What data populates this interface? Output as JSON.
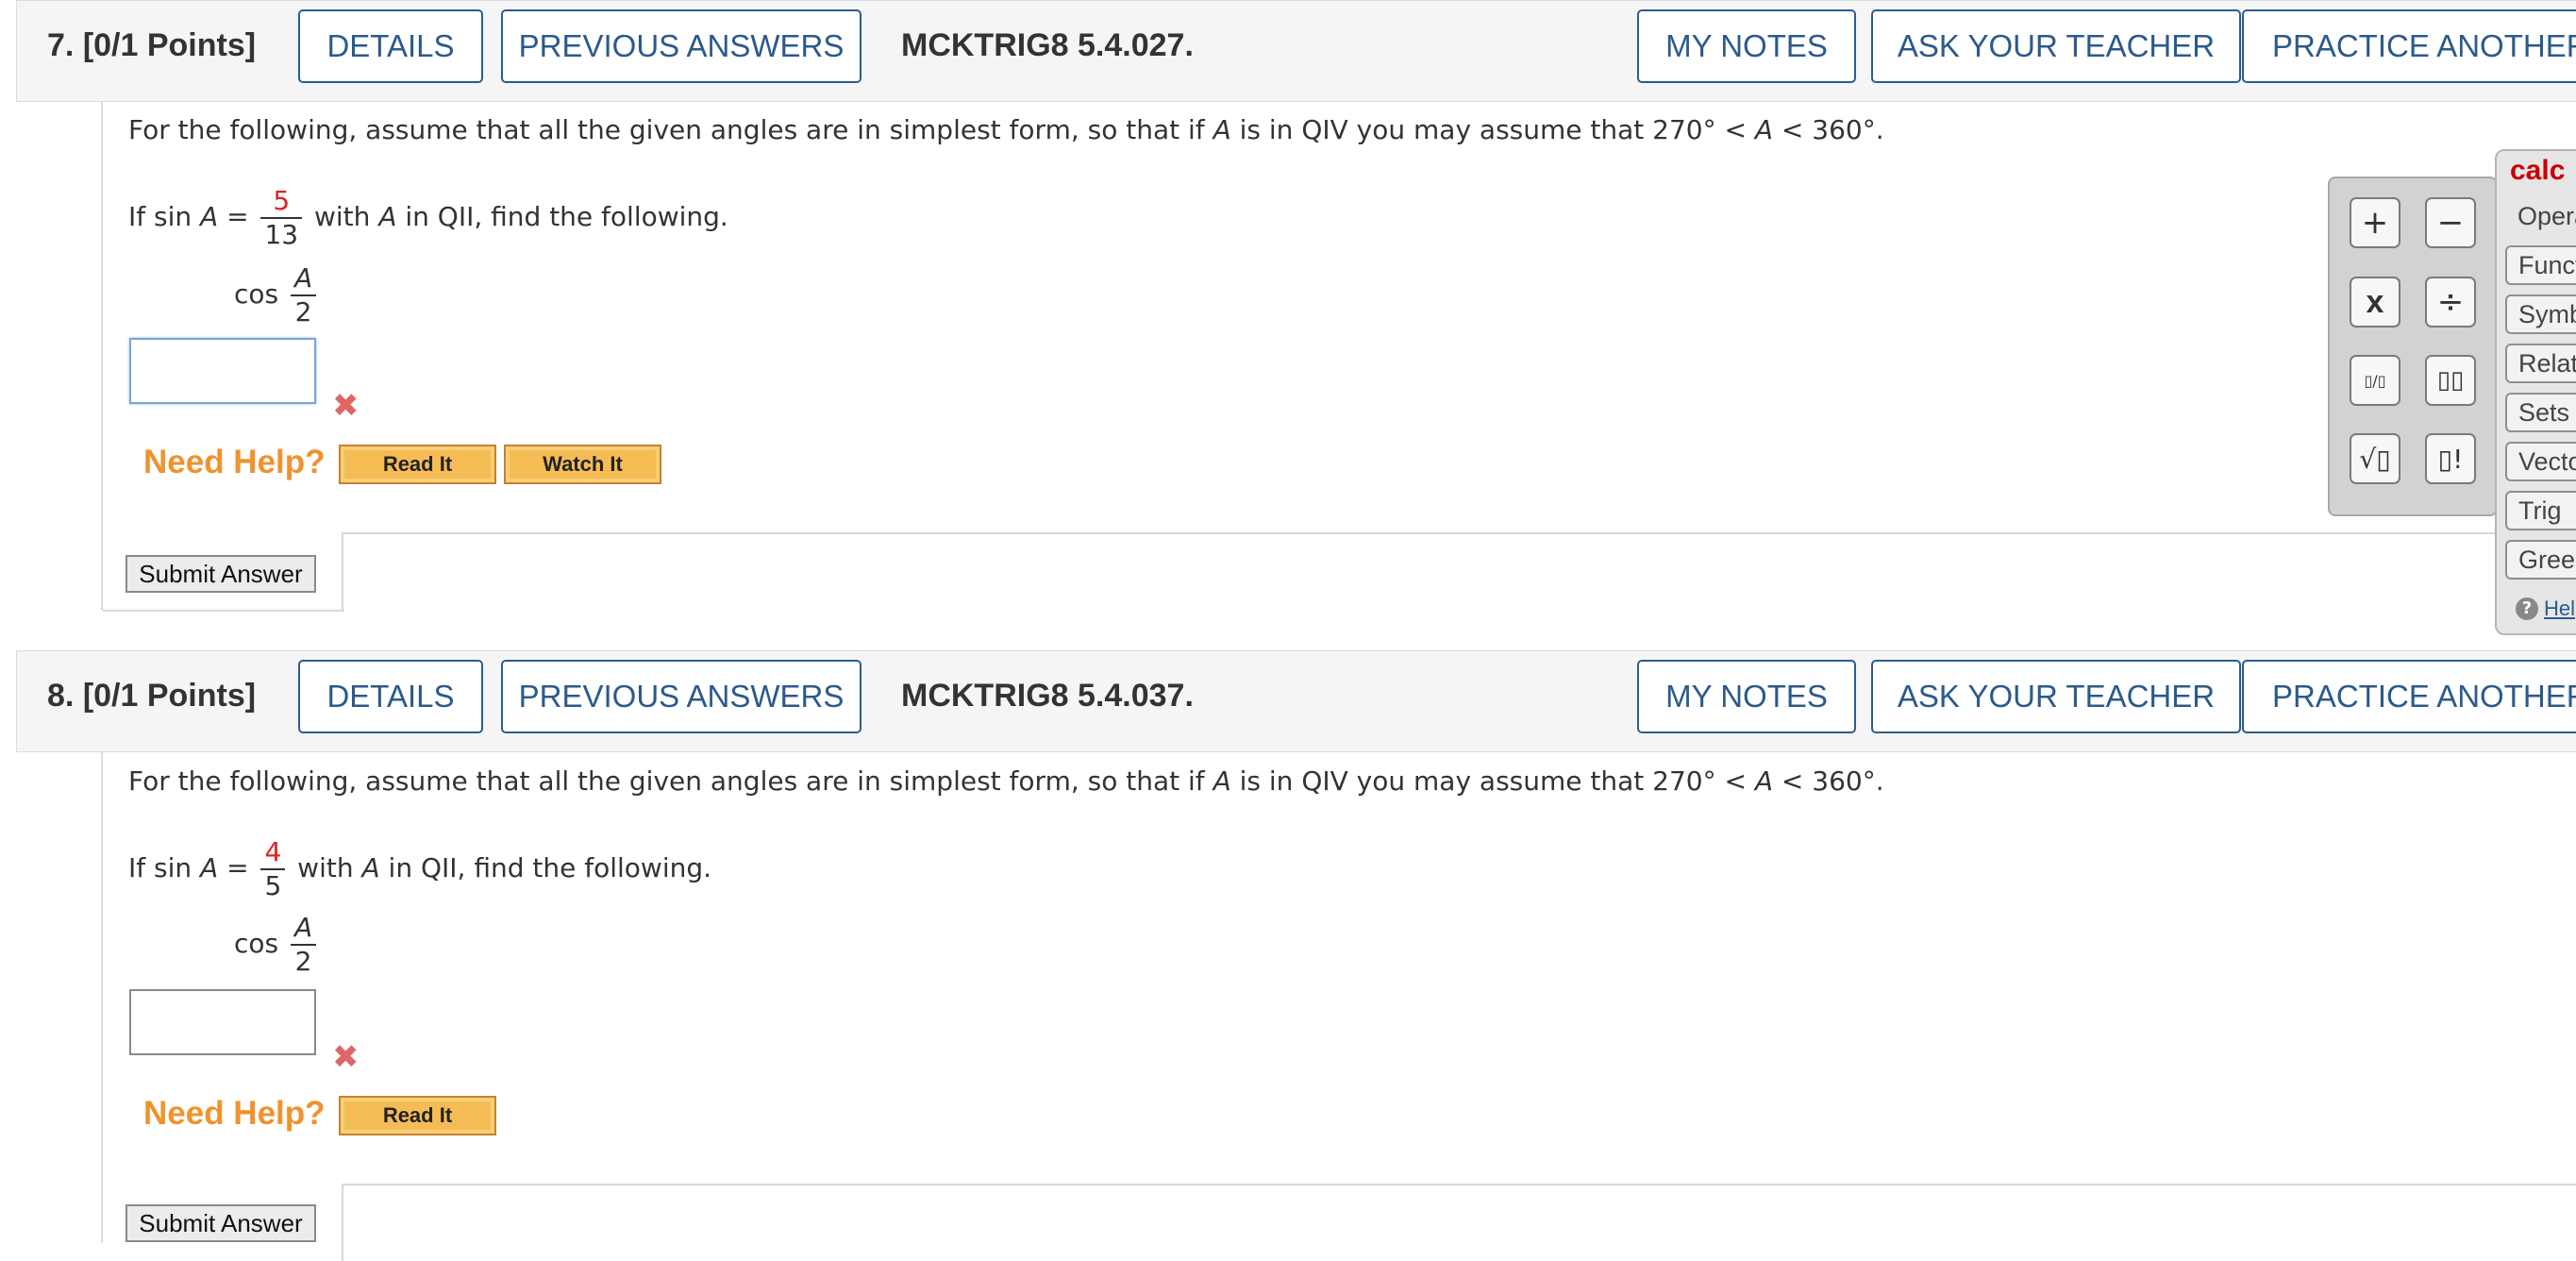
{
  "header_buttons": {
    "details": "DETAILS",
    "previous_answers": "PREVIOUS ANSWERS",
    "my_notes": "MY NOTES",
    "ask_teacher": "ASK YOUR TEACHER",
    "practice_another": "PRACTICE ANOTHER"
  },
  "common": {
    "instruction_pre": "For the following, assume that all the given angles are in simplest form, so that if ",
    "var_a": "A",
    "instruction_mid": " is in QIV you may assume that  270° < ",
    "instruction_post": " < 360°.",
    "if_sin": "If  sin ",
    "equals": " = ",
    "with": " with ",
    "in_qii": " in QII, find the following.",
    "cos": "cos ",
    "half_num": "A",
    "half_den": "2",
    "need_help": "Need Help?",
    "read_it": "Read It",
    "watch_it": "Watch It",
    "submit": "Submit Answer",
    "wrong_mark": "✖"
  },
  "questions": [
    {
      "number": "7.",
      "points": "[0/1 Points]",
      "code": "MCKTRIG8 5.4.027.",
      "sin_num": "5",
      "sin_den": "13",
      "answer_value": ""
    },
    {
      "number": "8.",
      "points": "[0/1 Points]",
      "code": "MCKTRIG8 5.4.037.",
      "sin_num": "4",
      "sin_den": "5",
      "answer_value": ""
    }
  ],
  "calculator": {
    "title": "calc",
    "operators_label": "Opera",
    "tabs": [
      "Funct",
      "Symb",
      "Relat",
      "Sets",
      "Vecto",
      "Trig",
      "Greel"
    ],
    "help": "Hel",
    "keys": [
      "+",
      "−",
      "x",
      "÷",
      "▯/▯",
      "▯▯",
      "√▯",
      "▯!"
    ]
  }
}
